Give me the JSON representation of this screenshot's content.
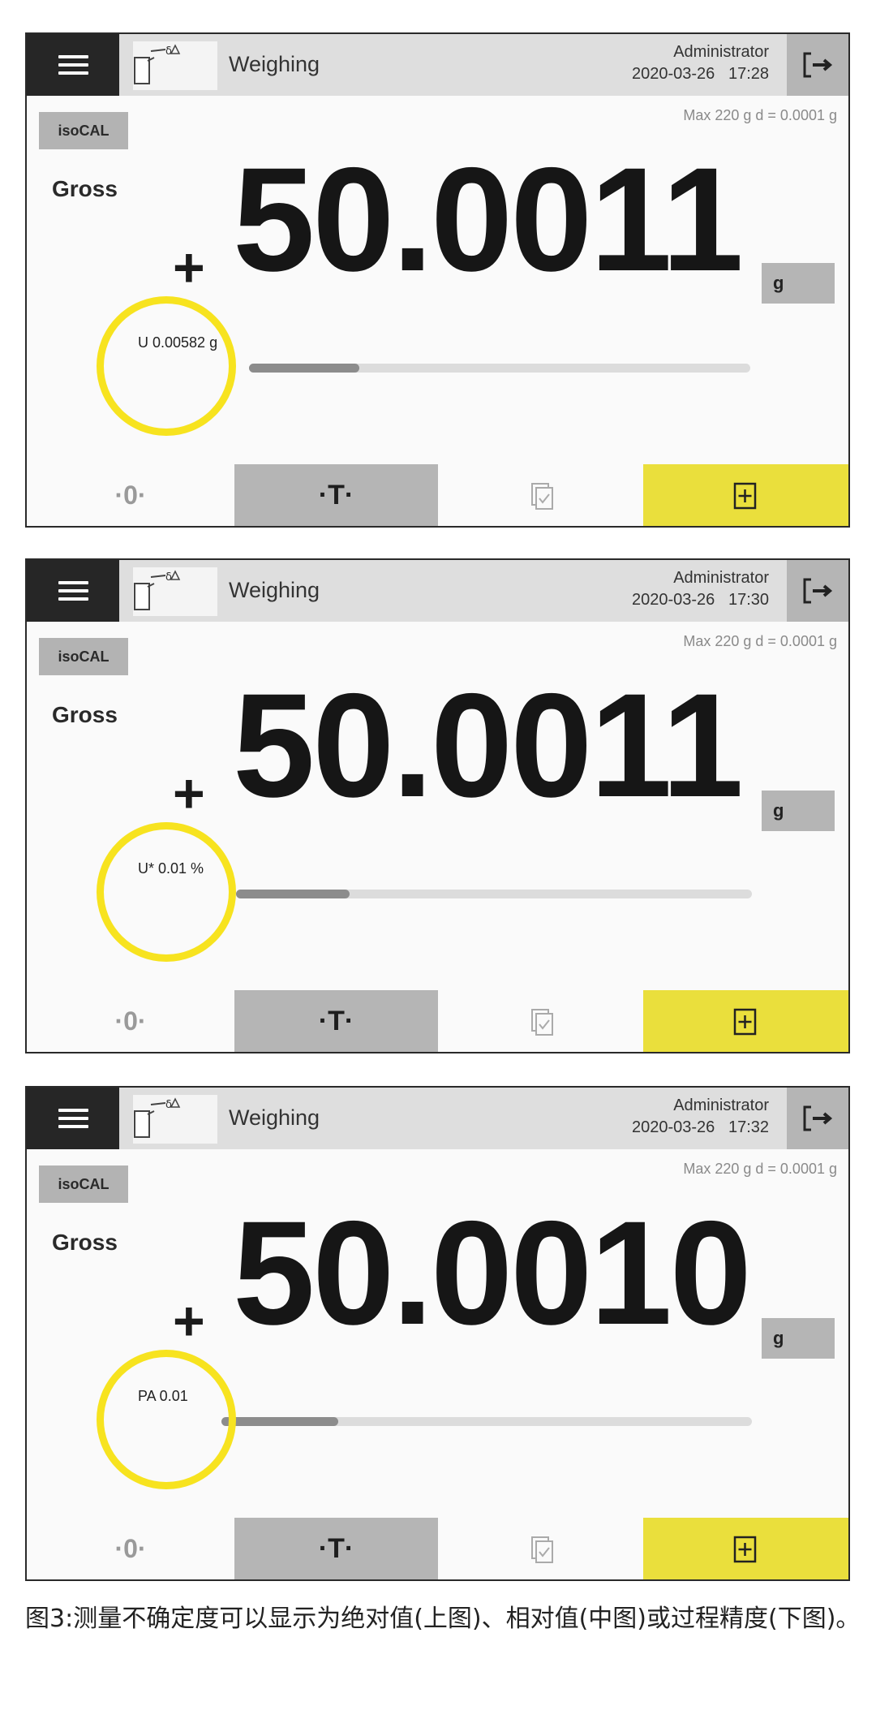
{
  "panels": [
    {
      "header": {
        "title": "Weighing",
        "user": "Administrator",
        "datetime": "2020-03-26   17:28"
      },
      "isocal_label": "isoCAL",
      "capacity": "Max 220 g  d = 0.0001 g",
      "mode_label": "Gross",
      "sign": "+",
      "weight_value": "50.0011",
      "unit": "g",
      "uncertainty_label": "U 0.00582 g",
      "stability_fill": 0.22,
      "buttons": {
        "zero": "·0·",
        "tare": "·T·"
      }
    },
    {
      "header": {
        "title": "Weighing",
        "user": "Administrator",
        "datetime": "2020-03-26   17:30"
      },
      "isocal_label": "isoCAL",
      "capacity": "Max 220 g  d = 0.0001 g",
      "mode_label": "Gross",
      "sign": "+",
      "weight_value": "50.0011",
      "unit": "g",
      "uncertainty_label": "U* 0.01 %",
      "stability_fill": 0.22,
      "buttons": {
        "zero": "·0·",
        "tare": "·T·"
      }
    },
    {
      "header": {
        "title": "Weighing",
        "user": "Administrator",
        "datetime": "2020-03-26   17:32"
      },
      "isocal_label": "isoCAL",
      "capacity": "Max 220 g  d = 0.0001 g",
      "mode_label": "Gross",
      "sign": "+",
      "weight_value": "50.0010",
      "unit": "g",
      "uncertainty_label": "PA 0.01",
      "stability_fill": 0.22,
      "buttons": {
        "zero": "·0·",
        "tare": "·T·"
      }
    }
  ],
  "icons": {
    "menu": "hamburger-menu-icon",
    "app": "weighing-scale-icon",
    "logout": "logout-icon",
    "check": "checklist-document-icon",
    "print": "add-document-icon"
  },
  "colors": {
    "highlight": "#f7e31f",
    "print_button": "#eadf3c",
    "menu_button": "#262626"
  },
  "caption": "图3:测量不确定度可以显示为绝对值(上图)、相对值(中图)或过程精度(下图)。"
}
